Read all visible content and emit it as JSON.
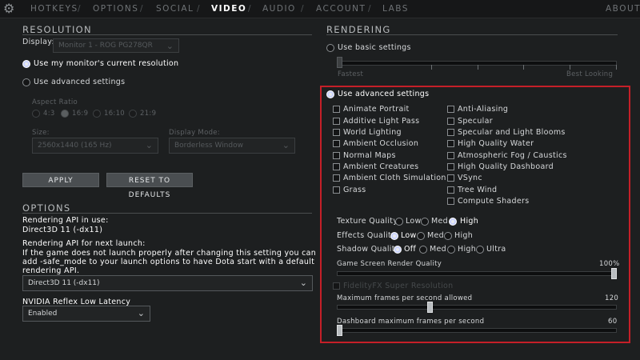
{
  "nav": {
    "tabs": [
      "HOTKEYS",
      "OPTIONS",
      "SOCIAL",
      "VIDEO",
      "AUDIO",
      "ACCOUNT",
      "LABS"
    ],
    "active": "VIDEO",
    "about": "ABOUT"
  },
  "resolution": {
    "header": "RESOLUTION",
    "display_label": "Display:",
    "display_value": "Monitor 1 - ROG PG278QR",
    "use_current": "Use my monitor's current resolution",
    "use_advanced": "Use advanced settings",
    "aspect_ratio_label": "Aspect Ratio",
    "aspect_options": [
      "4:3",
      "16:9",
      "16:10",
      "21:9"
    ],
    "size_label": "Size:",
    "size_value": "2560x1440 (165 Hz)",
    "display_mode_label": "Display Mode:",
    "display_mode_value": "Borderless Window",
    "apply": "APPLY",
    "reset": "RESET TO DEFAULTS"
  },
  "options": {
    "header": "OPTIONS",
    "api_in_use_label": "Rendering API in use:",
    "api_in_use_value": "Direct3D 11 (-dx11)",
    "api_next_label": "Rendering API for next launch:",
    "api_note_1": "If the game does not launch properly after changing this setting you can",
    "api_note_2": "add -safe_mode to your launch options to have Dota start with a default",
    "api_note_3": "rendering API.",
    "api_select": "Direct3D 11 (-dx11)",
    "reflex_label": "NVIDIA Reflex Low Latency",
    "reflex_value": "Enabled"
  },
  "rendering": {
    "header": "RENDERING",
    "use_basic": "Use basic settings",
    "fastest": "Fastest",
    "best_looking": "Best Looking",
    "basic_level": 0.0,
    "use_advanced": "Use advanced settings",
    "checkboxes_left": [
      "Animate Portrait",
      "Additive Light Pass",
      "World Lighting",
      "Ambient Occlusion",
      "Normal Maps",
      "Ambient Creatures",
      "Ambient Cloth Simulation",
      "Grass"
    ],
    "checkboxes_right": [
      "Anti-Aliasing",
      "Specular",
      "Specular and Light Blooms",
      "High Quality Water",
      "Atmospheric Fog / Caustics",
      "High Quality Dashboard",
      "VSync",
      "Tree Wind",
      "Compute Shaders"
    ],
    "texture_quality": {
      "label": "Texture Quality",
      "options": [
        "Low",
        "Med",
        "High"
      ],
      "selected": "High"
    },
    "effects_quality": {
      "label": "Effects Quality",
      "options": [
        "Low",
        "Med",
        "High"
      ],
      "selected": "Low"
    },
    "shadow_quality": {
      "label": "Shadow Quality",
      "options": [
        "Off",
        "Med",
        "High",
        "Ultra"
      ],
      "selected": "Off"
    },
    "render_quality_label": "Game Screen Render Quality",
    "render_quality_value": "100%",
    "render_quality_level": 1.0,
    "fsr_label": "FidelityFX Super Resolution",
    "max_fps_label": "Maximum frames per second allowed",
    "max_fps_value": "120",
    "max_fps_level": 0.33,
    "dash_fps_label": "Dashboard maximum frames per second",
    "dash_fps_value": "60",
    "dash_fps_level": 0.0
  },
  "colors": {
    "highlight_border": "#c51f28",
    "background": "#1d1f20"
  }
}
